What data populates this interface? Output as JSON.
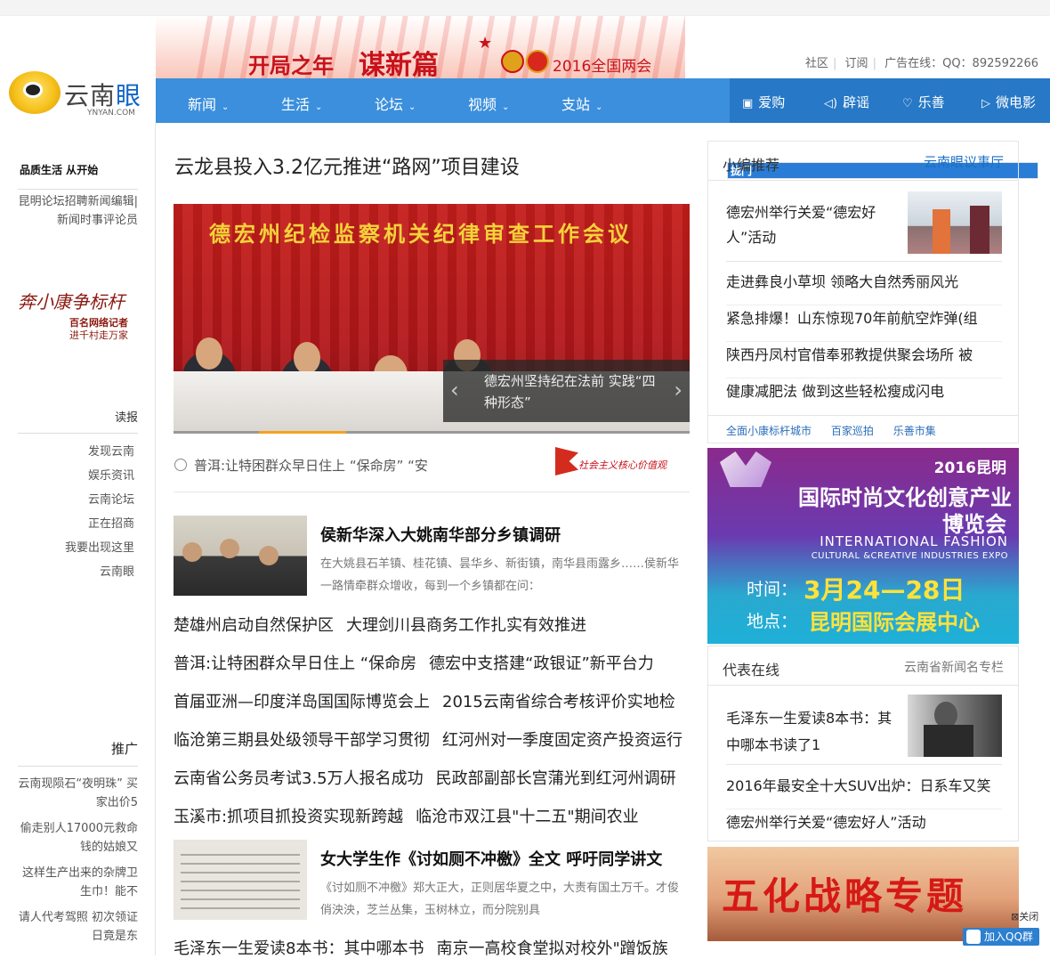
{
  "header": {
    "logo_text_1": "云南",
    "logo_text_2": "眼",
    "logo_sub": "YNYAN.COM",
    "banner_text_1": "开局之年",
    "banner_text_2": "谋新篇",
    "banner_text_3": "2016全国两会",
    "toplinks": [
      "社区",
      "订阅",
      "广告在线：QQ：892592266"
    ]
  },
  "nav": {
    "items": [
      "新闻",
      "生活",
      "论坛",
      "视频",
      "支站"
    ],
    "right_items": [
      "爱购",
      "辟谣",
      "乐善",
      "微电影"
    ]
  },
  "left": {
    "slogan_1": "品质生活 从",
    "slogan_box": "拢门",
    "slogan_2": "开始",
    "recruit": "昆明论坛招聘新闻编辑|新闻时事评论员",
    "calli": "奔小康争标杆",
    "calli_sub_1": "百名网络记者",
    "calli_sub_2": "进千村走万家",
    "read_title": "读报",
    "read_links": [
      "发现云南",
      "娱乐资讯",
      "云南论坛",
      "正在招商",
      "我要出现这里",
      "云南眼"
    ],
    "promo_title": "推广",
    "promo_links": [
      "云南现陨石“夜明珠” 买家出价5",
      "偷走别人17000元救命钱的姑娘又",
      "这样生产出来的杂牌卫生巾！能不",
      "请人代考驾照 初次领证日竟是东"
    ]
  },
  "main": {
    "headline": "云龙县投入3.2亿元推进“路网”项目建设",
    "photo_banner": "德宏州纪检监察机关纪律审查工作会议",
    "photo_caption": "德宏州坚持纪在法前 实践“四种形态”",
    "ticker": "普洱:让特困群众早日住上 “保命房” “安",
    "value_logo": "社会主义核心价值观",
    "story1_title": "侯新华深入大姚南华部分乡镇调研",
    "story1_desc": "在大姚县石羊镇、桂花镇、昙华乡、新街镇，南华县雨露乡……侯新华一路情牵群众增收，每到一个乡镇都在问：",
    "rows": [
      [
        "楚雄州启动自然保护区",
        "大理剑川县商务工作扎实有效推进"
      ],
      [
        "普洱:让特困群众早日住上 “保命房",
        "德宏中支搭建“政银证”新平台力"
      ],
      [
        "首届亚洲—印度洋岛国国际博览会上",
        "2015云南省综合考核评价实地检"
      ],
      [
        "临沧第三期县处级领导干部学习贯彻",
        "红河州对一季度固定资产投资运行"
      ],
      [
        "云南省公务员考试3.5万人报名成功",
        "民政部副部长宫蒲光到红河州调研"
      ],
      [
        "玉溪市:抓项目抓投资实现新跨越",
        "临沧市双江县\"十二五\"期间农业"
      ]
    ],
    "story2_title": "女大学生作《讨如厕不冲檄》全文 呼吁同学讲文",
    "story2_desc": "《讨如厕不冲檄》郑大正大，正则居华夏之中，大责有国土万千。才俊俏泱泱，芝兰丛集，玉树林立，而分院别具",
    "last_row": [
      "毛泽东一生爱读8本书：其中哪本书",
      "南京一高校食堂拟对校外\"蹭饭族"
    ]
  },
  "right": {
    "box1_title": "小编推荐",
    "box1_logo": "云南眼议事厅",
    "box1_top": "德宏州举行关爱“德宏好人”活动",
    "box1_links": [
      "走进彝良小草坝 领略大自然秀丽风光",
      "紧急排爆！山东惊现70年前航空炸弹(组",
      "陕西丹凤村官借奉邪教提供聚会场所 被",
      "健康减肥法 做到这些轻松瘦成闪电"
    ],
    "box1_tags": [
      "全面小康标杆城市",
      "百家巡拍",
      "乐善市集"
    ],
    "expo_year": "2016昆明",
    "expo_l1": "国际时尚文化创意产业",
    "expo_l2": "博览会",
    "expo_en1": "INTERNATIONAL FASHION",
    "expo_en2": "CULTURAL &CREATIVE INDUSTRIES EXPO",
    "expo_time_label": "时间：",
    "expo_time": "3月24—28日",
    "expo_place_label": "地点：",
    "expo_place": "昆明国际会展中心",
    "box2_title": "代表在线",
    "box2_extra": "云南省新闻名专栏",
    "box2_top": "毛泽东一生爱读8本书：其中哪本书读了1",
    "box2_links": [
      "2016年最安全十大SUV出炉：日系车又笑",
      "德宏州举行关爱“德宏好人”活动"
    ],
    "five_banner": "五化战略专题",
    "close": "关闭",
    "qq": "加入QQ群"
  }
}
